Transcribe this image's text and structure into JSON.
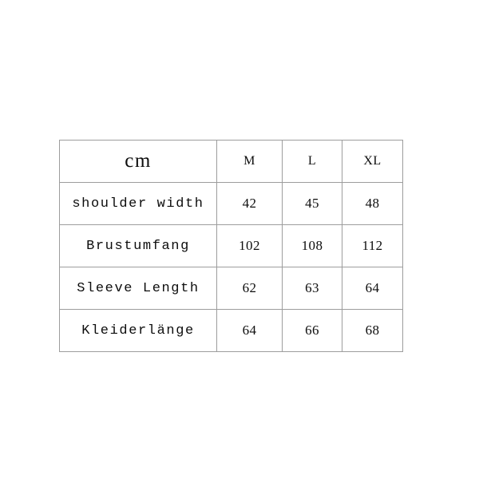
{
  "page": {
    "background_color": "#ffffff",
    "text_color": "#0d0d0d",
    "border_color": "#9d9d9d"
  },
  "table": {
    "unit_label": "cm",
    "size_columns": [
      "M",
      "L",
      "XL"
    ],
    "rows": [
      {
        "label": "shoulder width",
        "values": [
          "42",
          "45",
          "48"
        ]
      },
      {
        "label": "Brustumfang",
        "values": [
          "102",
          "108",
          "112"
        ]
      },
      {
        "label": "Sleeve Length",
        "values": [
          "62",
          "63",
          "64"
        ]
      },
      {
        "label": "Kleiderlänge",
        "values": [
          "64",
          "66",
          "68"
        ]
      }
    ]
  }
}
